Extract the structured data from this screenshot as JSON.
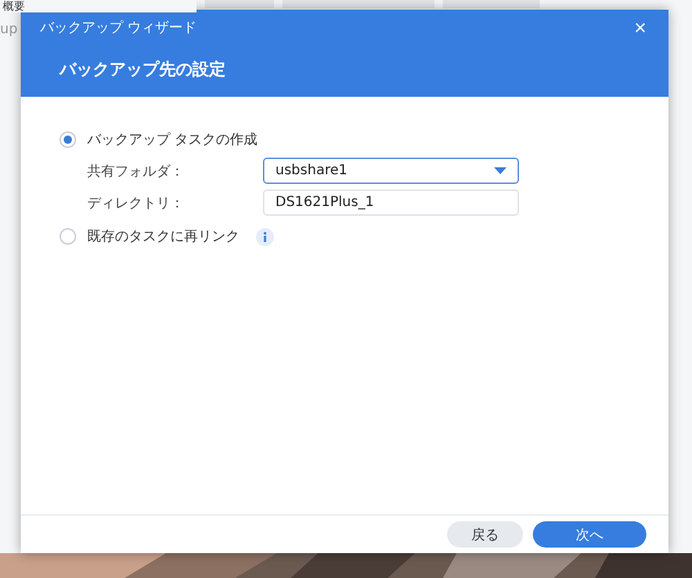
{
  "background_app": {
    "sidebar_item": "概要",
    "sidebar_fragment": "up"
  },
  "dialog": {
    "title": "バックアップ ウィザード",
    "close": "×",
    "heading": "バックアップ先の設定",
    "options": [
      {
        "label": "バックアップ タスクの作成",
        "selected": true,
        "info": false
      },
      {
        "label": "既存のタスクに再リンク",
        "selected": false,
        "info": true
      }
    ],
    "fields": [
      {
        "label": "共有フォルダ：",
        "value": "usbshare1",
        "kind": "dropdown"
      },
      {
        "label": "ディレクトリ：",
        "value": "DS1621Plus_1",
        "kind": "text"
      }
    ],
    "buttons": [
      {
        "label": "戻る",
        "kind": "secondary"
      },
      {
        "label": "次へ",
        "kind": "primary"
      }
    ]
  }
}
